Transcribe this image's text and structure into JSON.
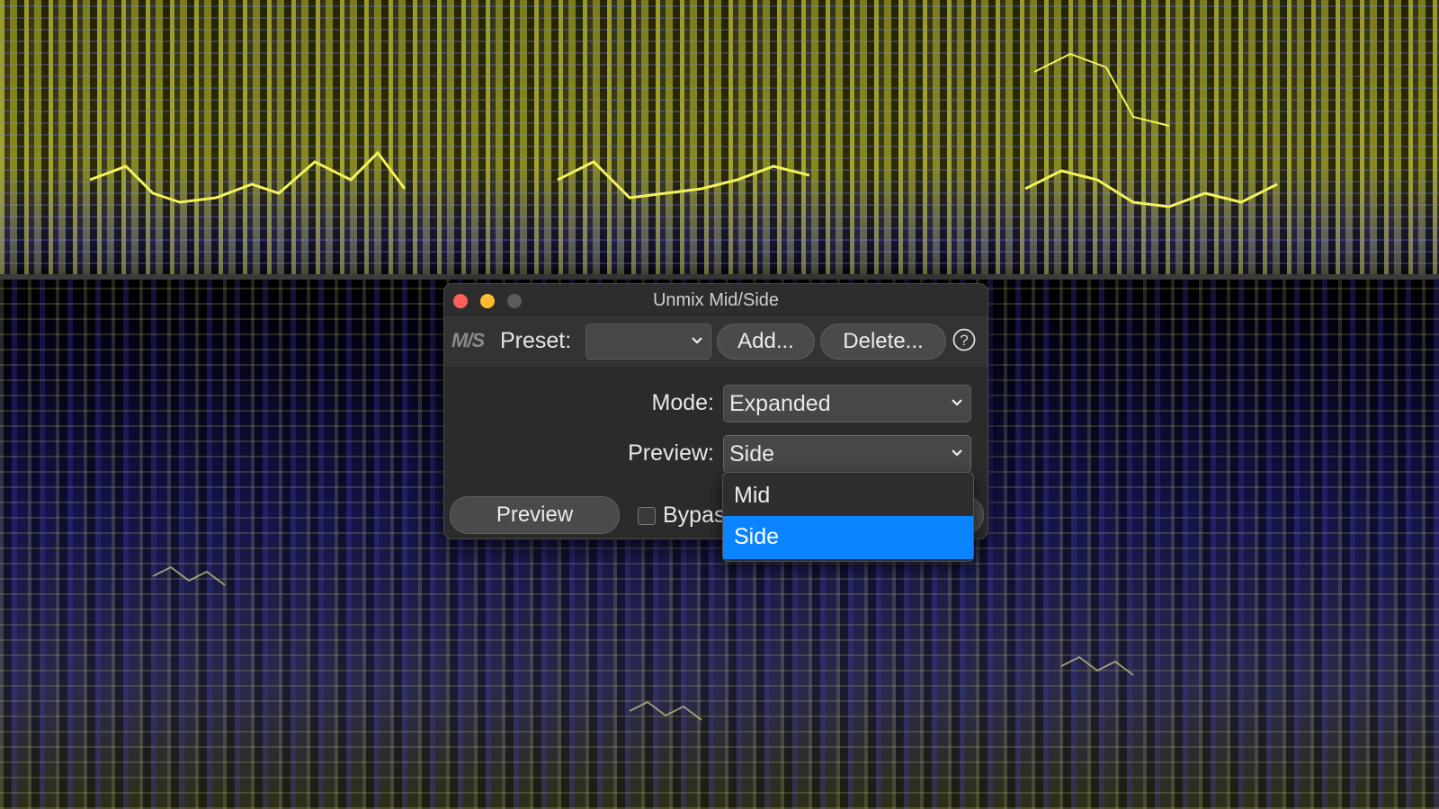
{
  "window": {
    "title": "Unmix Mid/Side",
    "traffic_lights": {
      "close": "#fe5f57",
      "minimize": "#febc2e",
      "zoom": "#5b5b5b"
    }
  },
  "toolbar": {
    "logo_text": "M/S",
    "preset_label": "Preset:",
    "preset_value": "",
    "add_label": "Add...",
    "delete_label": "Delete...",
    "help_icon": "question-circle-icon"
  },
  "form": {
    "mode_label": "Mode:",
    "mode_value": "Expanded",
    "preview_label": "Preview:",
    "preview_value": "Side"
  },
  "footer": {
    "preview_button": "Preview",
    "bypass_label": "Bypass",
    "bypass_checked": false
  },
  "dropdown": {
    "options": [
      "Mid",
      "Side"
    ],
    "selected": "Side",
    "highlight_color": "#0a84ff"
  }
}
